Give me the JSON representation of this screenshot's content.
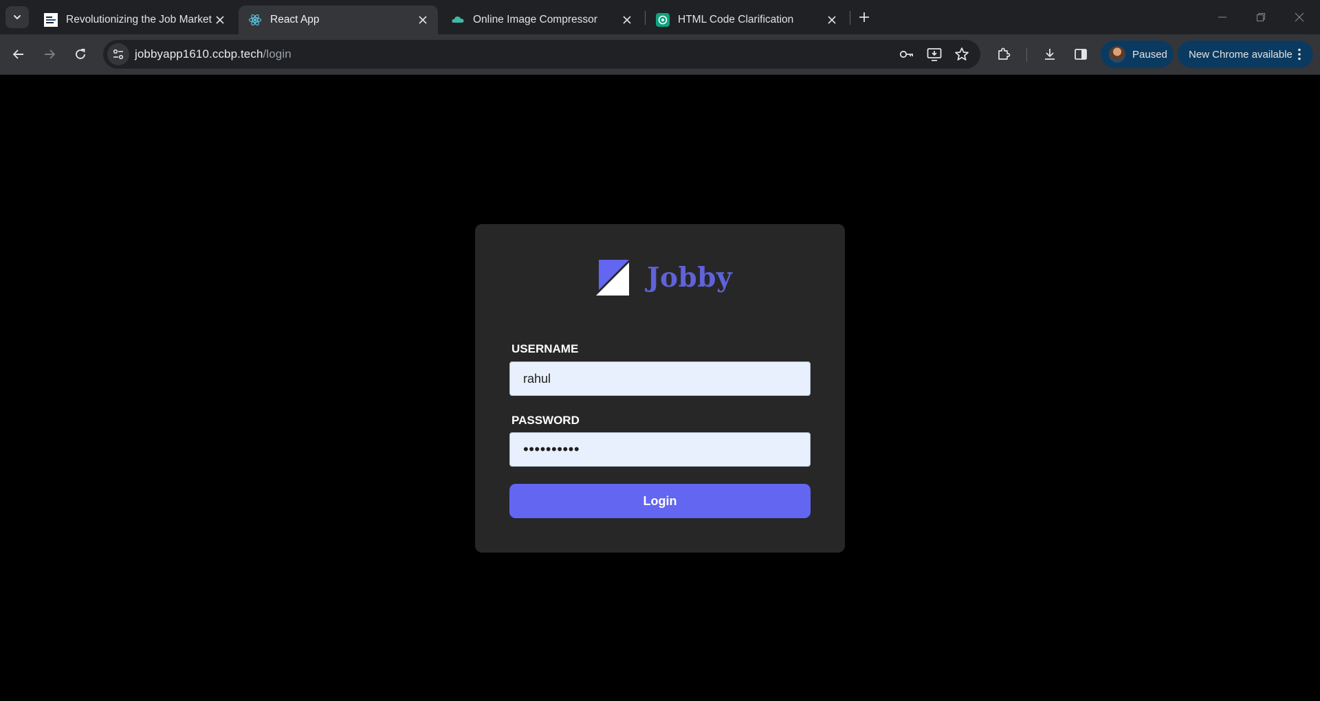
{
  "browser": {
    "tabs": [
      {
        "title": "Revolutionizing the Job Market",
        "favicon": "news-favicon",
        "active": false
      },
      {
        "title": "React App",
        "favicon": "react-logo-icon",
        "active": true
      },
      {
        "title": "Online Image Compressor",
        "favicon": "cloud-icon",
        "active": false
      },
      {
        "title": "HTML Code Clarification",
        "favicon": "chatgpt-icon",
        "active": false
      }
    ],
    "url": {
      "host": "jobbyapp1610.ccbp.tech",
      "path": "/login"
    },
    "profile_status": "Paused",
    "update_label": "New Chrome available",
    "colors": {
      "tabbar": "#202124",
      "toolbar": "#35363a",
      "update_pill": "#0b3a61"
    }
  },
  "page": {
    "logo_text": "Jobby",
    "username_label": "USERNAME",
    "username_value": "rahul",
    "password_label": "PASSWORD",
    "password_value": "••••••••••",
    "login_label": "Login",
    "colors": {
      "background": "#000000",
      "card": "#272727",
      "accent": "#6366f1",
      "logo": "#5f62d9",
      "input_bg": "#e8f0fe"
    }
  }
}
